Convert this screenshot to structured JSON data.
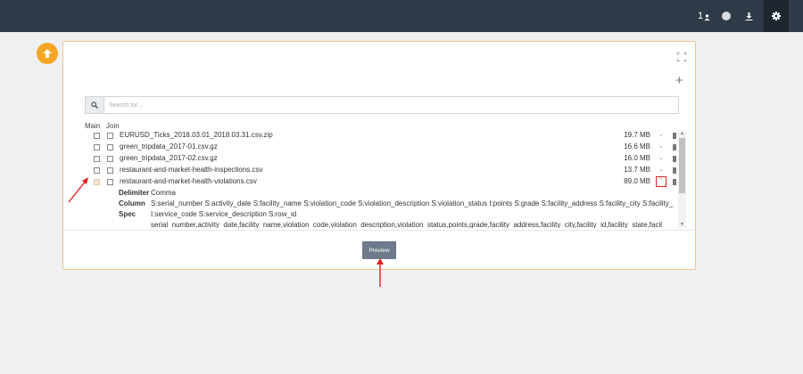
{
  "topbar": {
    "users_count": "1",
    "users_icon": "user-icon",
    "status_icon": "status-dot-icon",
    "download_icon": "download-icon",
    "settings_icon": "gear-icon"
  },
  "upload_icon": "upload-arrow-icon",
  "search": {
    "placeholder": "Search for...",
    "value": ""
  },
  "columns": {
    "main": "Main",
    "join": "Join"
  },
  "files": [
    {
      "name": "EURUSD_Ticks_2018.03.01_2018.03.31.csv.zip",
      "size": "19.7 MB"
    },
    {
      "name": "green_tripdata_2017-01.csv.gz",
      "size": "16.6 MB"
    },
    {
      "name": "green_tripdata_2017-02.csv.gz",
      "size": "16.0 MB"
    },
    {
      "name": "restaurant-and-market-health-inspections.csv",
      "size": "13.7 MB"
    },
    {
      "name": "restaurant-and-market-health-violations.csv",
      "size": "89.0 MB"
    }
  ],
  "details": {
    "delimiter_label": "Delimiter",
    "delimiter_value": "Comma",
    "column_spec_label_1": "Column",
    "column_spec_label_2": "Spec",
    "column_spec_line_1": "S:serial_number S:activity_date S:facility_name S:violation_code S:violation_description S:violation_status I:points S:grade S:facility_address S:facility_city S:facility_",
    "column_spec_line_2": "I:service_code S:service_description S:row_id",
    "header_line": "serial_number,activity_date,facility_name,violation_code,violation_description,violation_status,points,grade,facility_address,facility_city,facility_id,facility_state,facil"
  },
  "preview_label": "Preview",
  "colors": {
    "topbar": "#2f3a48",
    "accent": "#f5a623",
    "preview_button": "#6c7a89",
    "annotation": "#e02020"
  }
}
